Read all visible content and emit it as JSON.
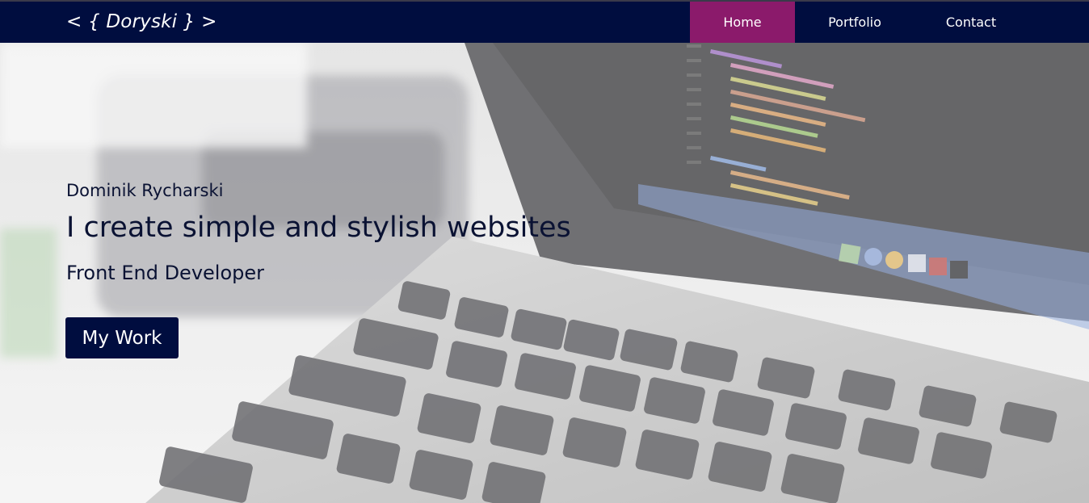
{
  "nav": {
    "logo": "< { Doryski } >",
    "items": [
      {
        "label": "Home",
        "active": true
      },
      {
        "label": "Portfolio",
        "active": false
      },
      {
        "label": "Contact",
        "active": false
      }
    ]
  },
  "hero": {
    "name": "Dominik Rycharski",
    "headline": "I create simple and stylish websites",
    "role": "Front End Developer",
    "cta_label": "My Work"
  },
  "colors": {
    "navbar": "#000d3f",
    "active_nav": "#8b1a6b",
    "text": "#0a1233"
  }
}
